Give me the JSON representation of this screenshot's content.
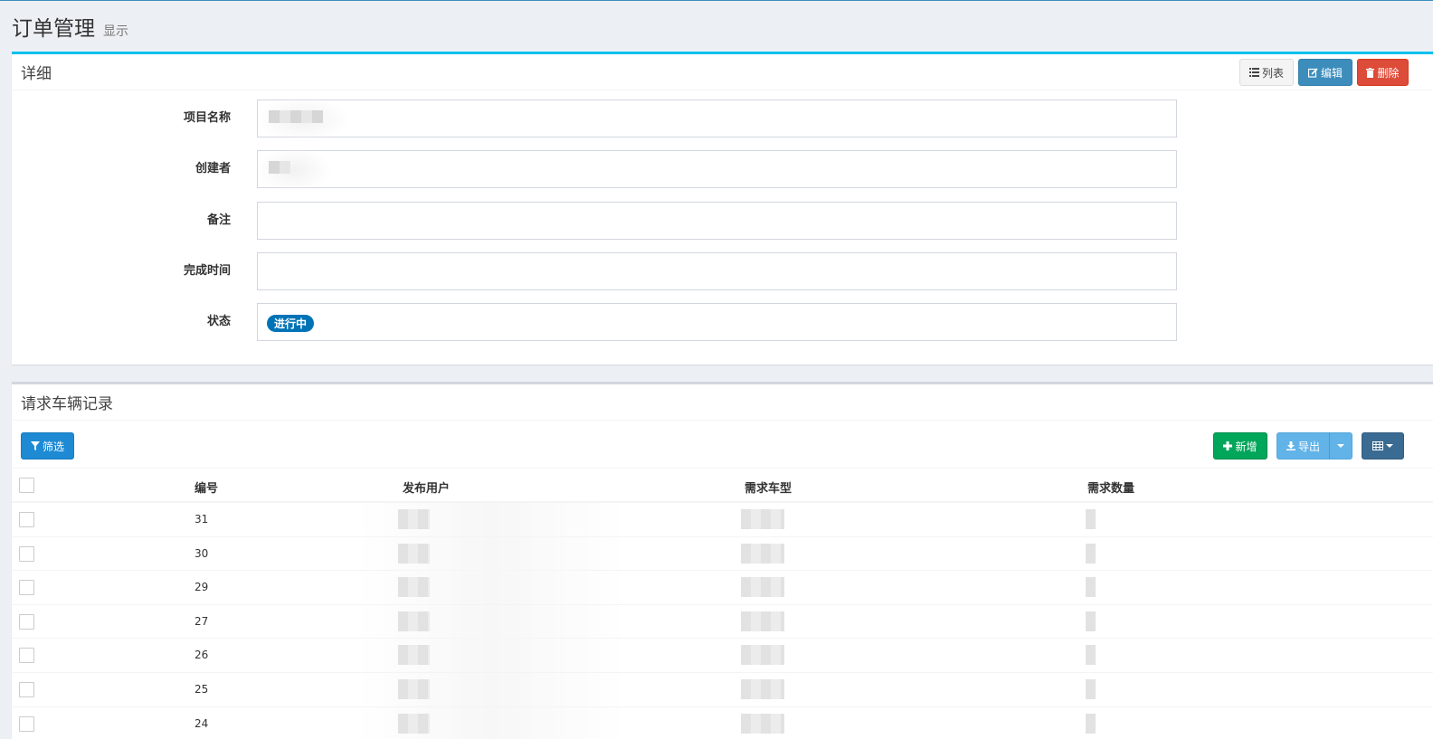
{
  "page": {
    "title": "订单管理",
    "subtitle": "显示"
  },
  "detail": {
    "title": "详细",
    "buttons": {
      "list": "列表",
      "edit": "编辑",
      "delete": "删除"
    },
    "fields": [
      {
        "label": "项目名称",
        "value": ""
      },
      {
        "label": "创建者",
        "value": ""
      },
      {
        "label": "备注",
        "value": ""
      },
      {
        "label": "完成时间",
        "value": ""
      },
      {
        "label": "状态",
        "value": "进行中"
      }
    ]
  },
  "records": {
    "title": "请求车辆记录",
    "buttons": {
      "filter": "筛选",
      "add": "新增",
      "export": "导出"
    },
    "columns": [
      "编号",
      "发布用户",
      "需求车型",
      "需求数量"
    ],
    "rows": [
      {
        "id": "31"
      },
      {
        "id": "30"
      },
      {
        "id": "29"
      },
      {
        "id": "27"
      },
      {
        "id": "26"
      },
      {
        "id": "25"
      },
      {
        "id": "24"
      }
    ]
  },
  "icons": {
    "list": "list-icon",
    "edit": "edit-icon",
    "delete": "trash-icon",
    "filter": "filter-icon",
    "add": "plus-icon",
    "export": "download-icon",
    "grid": "table-grid-icon"
  },
  "colors": {
    "accent": "#00c0ef",
    "status_badge": "#0073b7",
    "delete": "#dd4b39",
    "add": "#00a65a"
  }
}
